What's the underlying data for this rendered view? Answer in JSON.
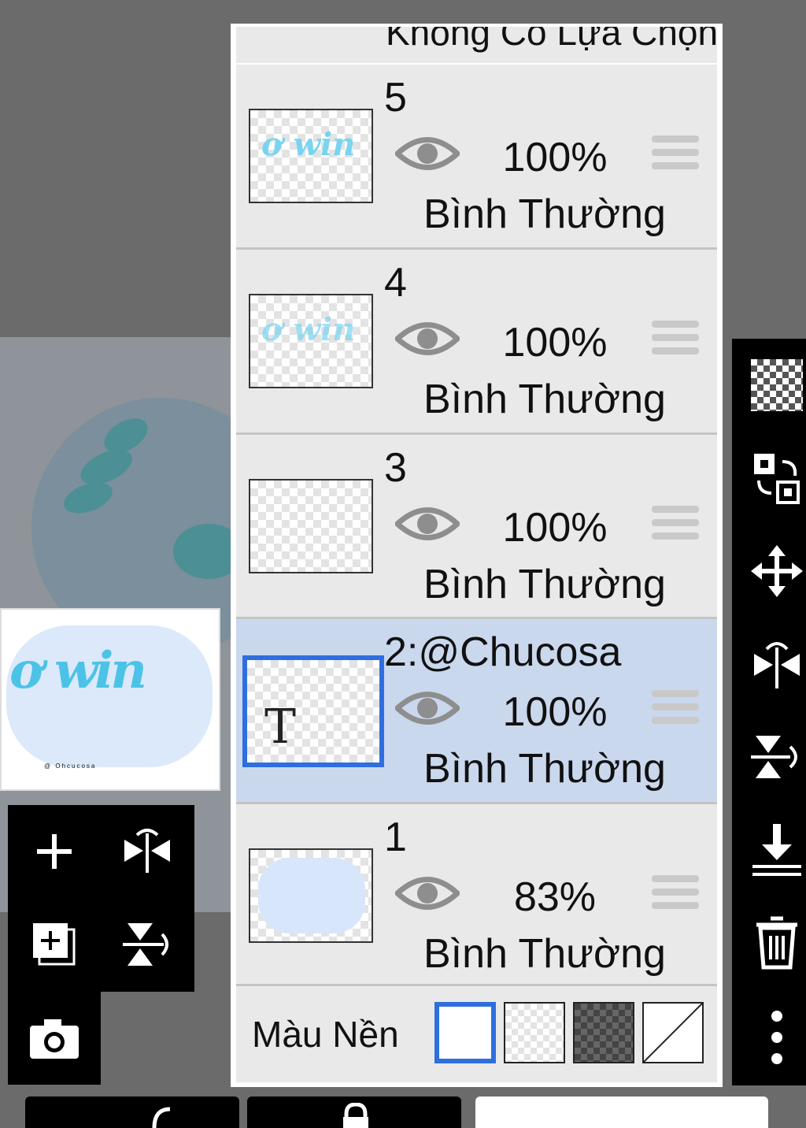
{
  "panel": {
    "header_label": "Không Có Lựa Chọn"
  },
  "layers": [
    {
      "name": "5",
      "opacity": "100%",
      "blend": "Bình Thường",
      "selected": false
    },
    {
      "name": "4",
      "opacity": "100%",
      "blend": "Bình Thường",
      "selected": false
    },
    {
      "name": "3",
      "opacity": "100%",
      "blend": "Bình Thường",
      "selected": false
    },
    {
      "name": "2:@Chucosa",
      "opacity": "100%",
      "blend": "Bình Thường",
      "selected": true,
      "thumb_glyph": "T"
    },
    {
      "name": "1",
      "opacity": "83%",
      "blend": "Bình Thường",
      "selected": false
    }
  ],
  "background": {
    "label": "Màu Nền",
    "options": [
      "white-bg",
      "transparent-bg",
      "dark-checker-bg",
      "none-bg"
    ],
    "selected_option": "white-bg"
  },
  "navigator": {
    "handle_text": "@ Ohcucosa"
  },
  "colors": {
    "accent": "#2f6fdd",
    "panel_bg": "#e9e9e9",
    "selected_row": "#cad8ee",
    "toolbar": "#000000"
  },
  "icons": {
    "left_toolbar": [
      "add-layer-icon",
      "flip-horizontal-icon",
      "add-copy-layer-icon",
      "flip-vertical-icon",
      "camera-icon"
    ],
    "right_toolbar": [
      "transparency-icon",
      "swap-layers-icon",
      "move-icon",
      "flip-horizontal-icon",
      "flip-vertical-icon",
      "merge-down-icon",
      "trash-icon",
      "more-vert-icon"
    ]
  }
}
